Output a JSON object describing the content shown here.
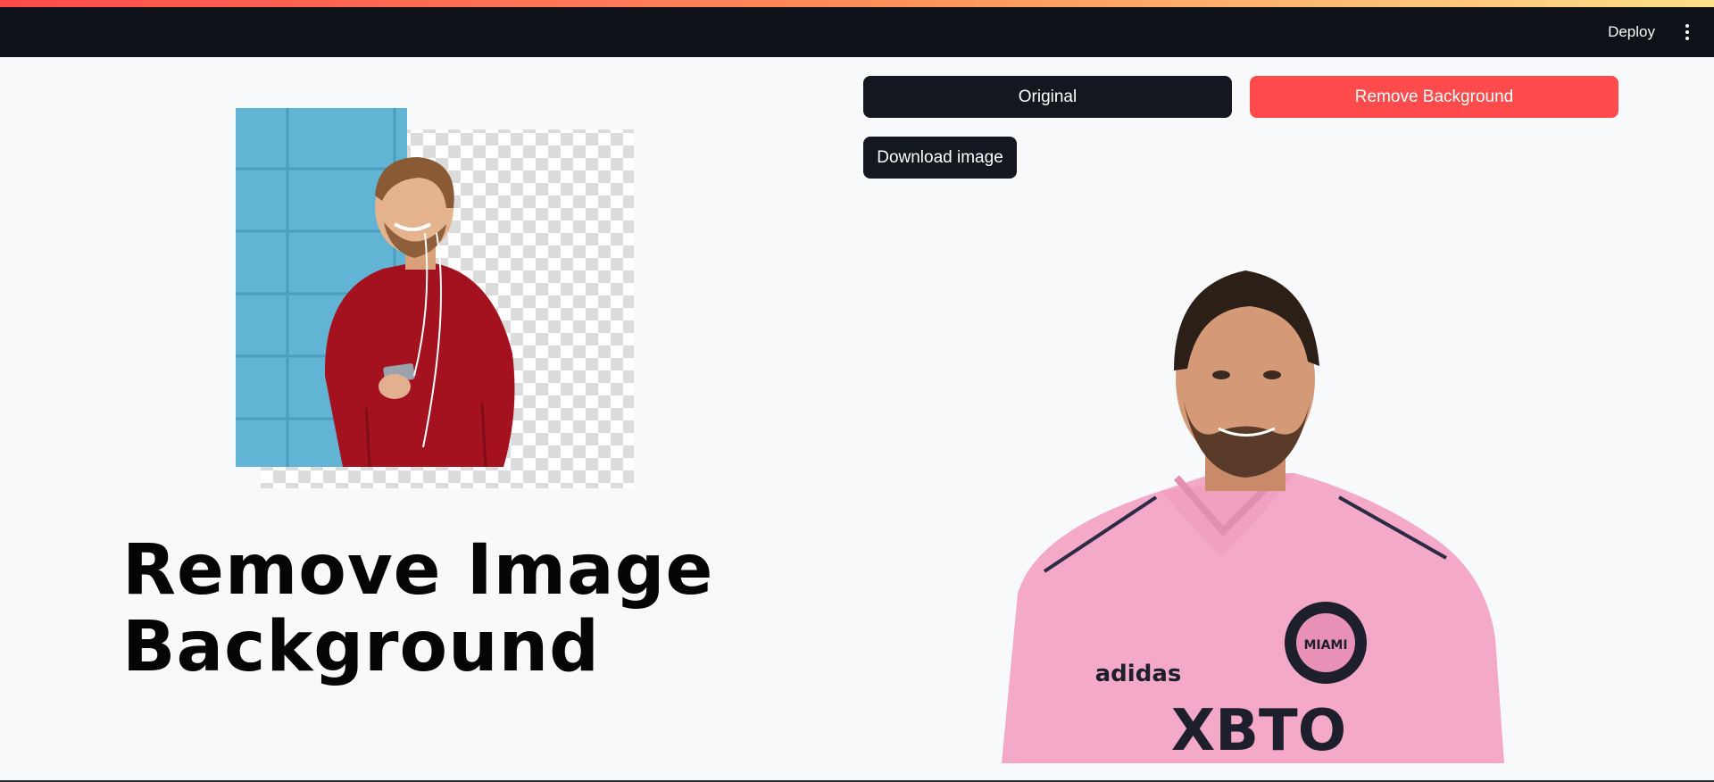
{
  "header": {
    "deploy_label": "Deploy",
    "menu_icon": "kebab-menu-icon"
  },
  "hero": {
    "title": "Remove Image Background",
    "image_description_icon": "hero-image"
  },
  "actions": {
    "original_label": "Original",
    "remove_background_label": "Remove Background",
    "download_label": "Download image"
  },
  "colors": {
    "header_bg": "#0e1117",
    "page_bg": "#f8f9fa",
    "primary": "#ff4b4b",
    "secondary_button": "#131720",
    "stripe_start": "#ff4b4b",
    "stripe_end": "#ffe08a"
  }
}
